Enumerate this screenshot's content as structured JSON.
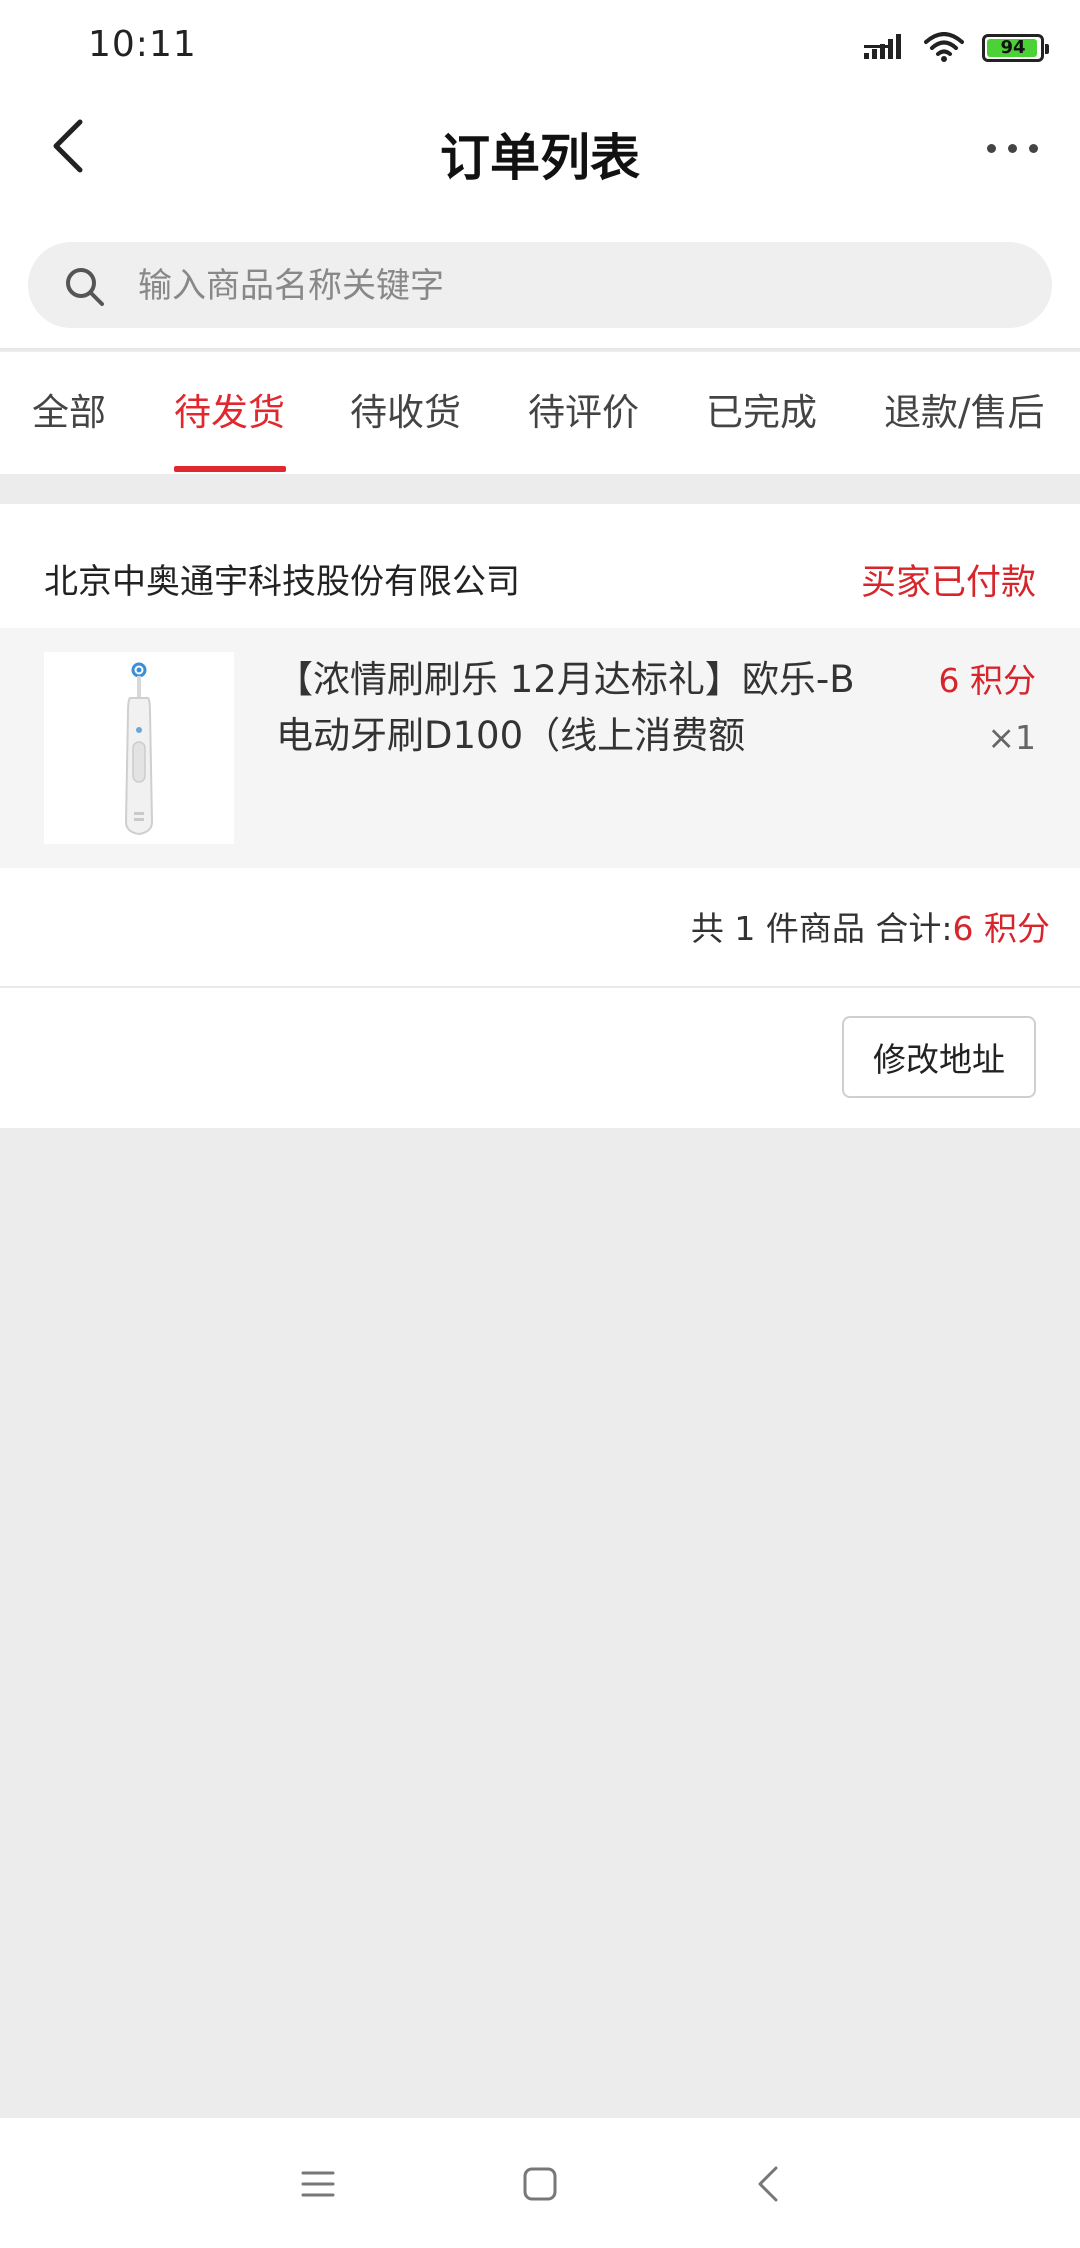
{
  "status_bar": {
    "time": "10:11",
    "battery": "94",
    "icons": [
      "signal-icon",
      "wifi-icon",
      "battery-icon"
    ]
  },
  "header": {
    "title": "订单列表",
    "back_icon": "chevron-left-icon",
    "more_icon": "more-horizontal-icon"
  },
  "search": {
    "placeholder": "输入商品名称关键字",
    "value": "",
    "icon": "search-icon"
  },
  "tabs": [
    {
      "label": "全部",
      "active": false
    },
    {
      "label": "待发货",
      "active": true
    },
    {
      "label": "待收货",
      "active": false
    },
    {
      "label": "待评价",
      "active": false
    },
    {
      "label": "已完成",
      "active": false
    },
    {
      "label": "退款/售后",
      "active": false
    }
  ],
  "order": {
    "shop_name": "北京中奥通宇科技股份有限公司",
    "status": "买家已付款",
    "product": {
      "title": "【浓情刷刷乐 12月达标礼】欧乐-B电动牙刷D100（线上消费额",
      "price": "6 积分",
      "quantity": "×1",
      "image": "electric-toothbrush"
    },
    "summary_prefix": "共 1 件商品 合计:",
    "summary_total": "6 积分",
    "action_label": "修改地址"
  },
  "nav_bar": {
    "icons": [
      "menu-icon",
      "home-square-icon",
      "back-triangle-icon"
    ]
  },
  "colors": {
    "accent": "#e0282e",
    "background": "#ececec",
    "card": "#ffffff",
    "product_row": "#f5f5f5"
  }
}
